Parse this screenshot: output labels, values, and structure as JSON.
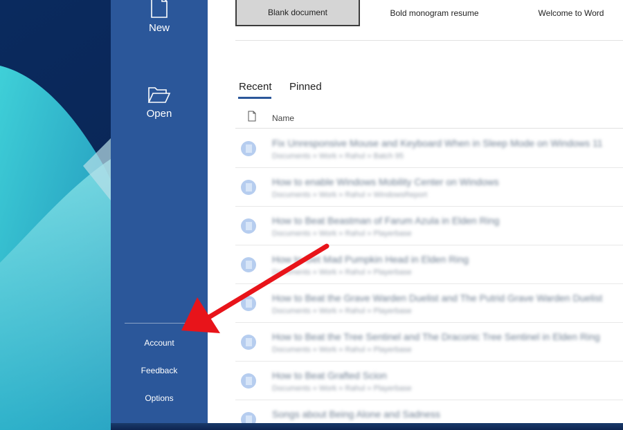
{
  "sidebar": {
    "new_label": "New",
    "open_label": "Open",
    "account_label": "Account",
    "feedback_label": "Feedback",
    "options_label": "Options",
    "icons": [
      "new-document-icon",
      "open-folder-icon"
    ],
    "background": "#2b579a"
  },
  "templates": {
    "blank": "Blank document",
    "resume": "Bold monogram resume",
    "welcome": "Welcome to Word"
  },
  "tabs": {
    "recent": "Recent",
    "pinned": "Pinned",
    "active": "Recent"
  },
  "file_list": {
    "name_header": "Name",
    "rows": [
      {
        "title": "Fix Unresponsive Mouse and Keyboard When in Sleep Mode on Windows 11",
        "path": "Documents » Work » Rahul » Batch 95"
      },
      {
        "title": "How to enable Windows Mobility Center on Windows",
        "path": "Documents » Work » Rahul » WindowsReport"
      },
      {
        "title": "How to Beat Beastman of Farum Azula in Elden Ring",
        "path": "Documents » Work » Rahul » Playerbase"
      },
      {
        "title": "How to Get Mad Pumpkin Head in Elden Ring",
        "path": "Documents » Work » Rahul » Playerbase"
      },
      {
        "title": "How to Beat the Grave Warden Duelist and The Putrid Grave Warden Duelist",
        "path": "Documents » Work » Rahul » Playerbase"
      },
      {
        "title": "How to Beat the Tree Sentinel and The Draconic Tree Sentinel in Elden Ring",
        "path": "Documents » Work » Rahul » Playerbase"
      },
      {
        "title": "How to Beat Grafted Scion",
        "path": "Documents » Work » Rahul » Playerbase"
      },
      {
        "title": "Songs about Being Alone and Sadness",
        "path": ""
      }
    ]
  },
  "colors": {
    "accent": "#2b579a",
    "annotation_arrow": "#e8141a"
  }
}
